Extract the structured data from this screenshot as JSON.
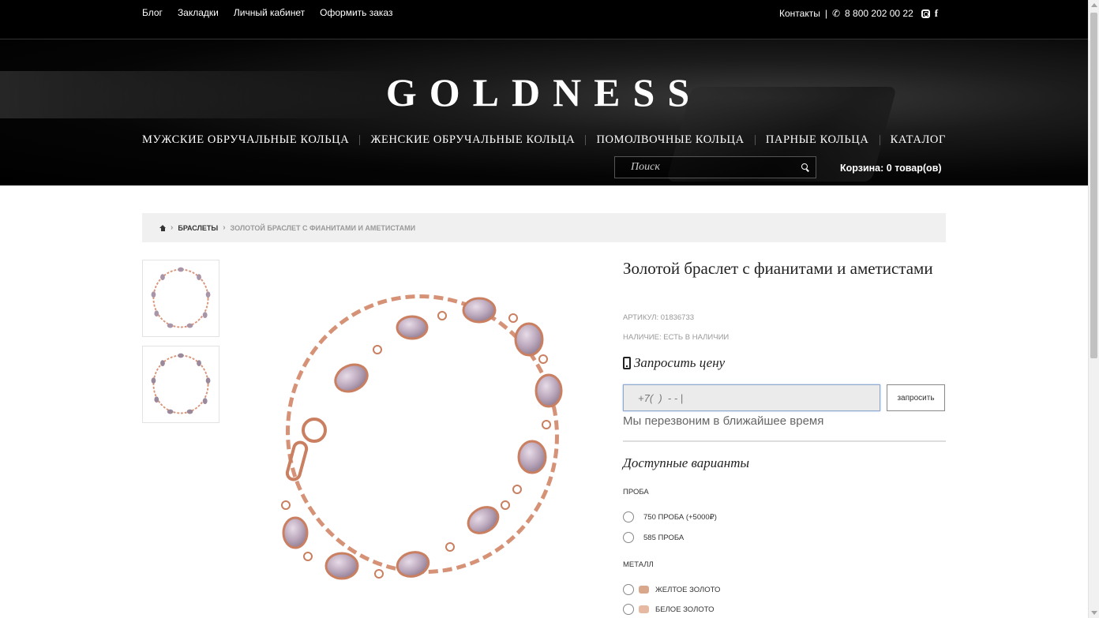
{
  "topbar": {
    "links": [
      "Блог",
      "Закладки",
      "Личный кабинет",
      "Оформить заказ"
    ],
    "contacts_label": "Контакты",
    "separator": "|",
    "phone": "8 800 202 00 22"
  },
  "header": {
    "logo": "GOLDNESS",
    "nav": [
      "МУЖСКИЕ ОБРУЧАЛЬНЫЕ КОЛЬЦА",
      "ЖЕНСКИЕ ОБРУЧАЛЬНЫЕ КОЛЬЦА",
      "ПОМОЛВОЧНЫЕ КОЛЬЦА",
      "ПАРНЫЕ КОЛЬЦА",
      "КАТАЛОГ"
    ],
    "search_placeholder": "Поиск",
    "cart": "Корзина: 0 товар(ов)"
  },
  "breadcrumb": {
    "section": "БРАСЛЕТЫ",
    "current": "ЗОЛОТОЙ БРАСЛЕТ С ФИАНИТАМИ И АМЕТИСТАМИ"
  },
  "product": {
    "title": "Золотой браслет с фианитами и аметистами",
    "sku": "АРТИКУЛ: 01836733",
    "availability": "НАЛИЧИЕ: ЕСТЬ В НАЛИЧИИ",
    "request_heading": "Запросить цену",
    "phone_value": "+7(  )  - - |",
    "request_button": "запросить",
    "callback_note": "Мы перезвоним в ближайшее время",
    "variants_title": "Доступные варианты",
    "groups": {
      "probe": {
        "label": "ПРОБА",
        "options": [
          "750 ПРОБА (+5000₽)",
          "585 ПРОБА"
        ]
      },
      "metal": {
        "label": "МЕТАЛЛ",
        "options": [
          "ЖЕЛТОЕ ЗОЛОТО",
          "БЕЛОЕ ЗОЛОТО"
        ]
      }
    }
  },
  "colors": {
    "rose_gold": "#d9967a",
    "amethyst": "#b8a6b8",
    "yellow_gold_swatch": "#d9a88c",
    "white_gold_swatch": "#e7b9a3"
  }
}
